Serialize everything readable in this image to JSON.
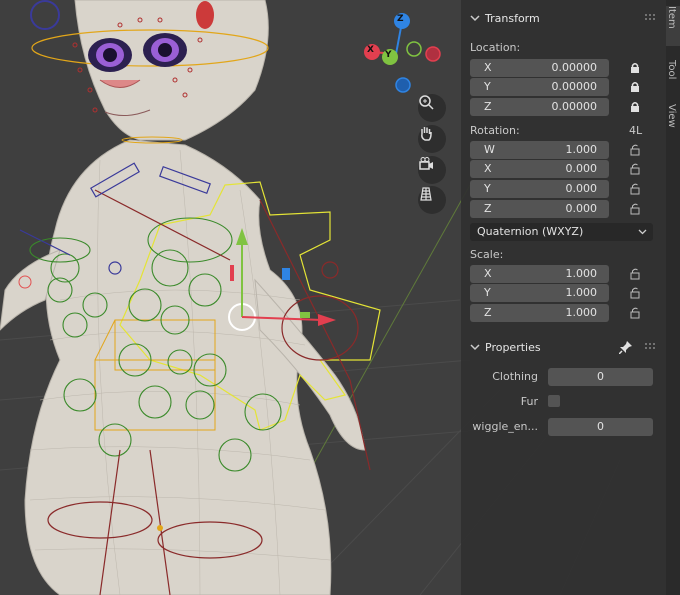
{
  "transform_panel": {
    "title": "Transform",
    "location": {
      "label": "Location:",
      "fields": [
        {
          "axis": "X",
          "value": "0.00000"
        },
        {
          "axis": "Y",
          "value": "0.00000"
        },
        {
          "axis": "Z",
          "value": "0.00000"
        }
      ]
    },
    "rotation": {
      "label": "Rotation:",
      "lock_4l": "4L",
      "fields": [
        {
          "axis": "W",
          "value": "1.000"
        },
        {
          "axis": "X",
          "value": "0.000"
        },
        {
          "axis": "Y",
          "value": "0.000"
        },
        {
          "axis": "Z",
          "value": "0.000"
        }
      ],
      "mode": "Quaternion (WXYZ)"
    },
    "scale": {
      "label": "Scale:",
      "fields": [
        {
          "axis": "X",
          "value": "1.000"
        },
        {
          "axis": "Y",
          "value": "1.000"
        },
        {
          "axis": "Z",
          "value": "1.000"
        }
      ]
    }
  },
  "properties_panel": {
    "title": "Properties",
    "items": [
      {
        "label": "Clothing",
        "value": "0"
      },
      {
        "label": "Fur",
        "value": ""
      },
      {
        "label": "wiggle_en...",
        "value": "0"
      }
    ]
  },
  "gizmo": {
    "z": "Z",
    "y": "Y",
    "x": "X"
  },
  "sidebar_tabs": [
    "Item",
    "Tool",
    "View"
  ],
  "colors": {
    "x_axis": "#e23f4f",
    "y_axis": "#80c341",
    "z_axis": "#2f84e3",
    "panel_bg": "#303030",
    "field_bg": "#545454"
  }
}
